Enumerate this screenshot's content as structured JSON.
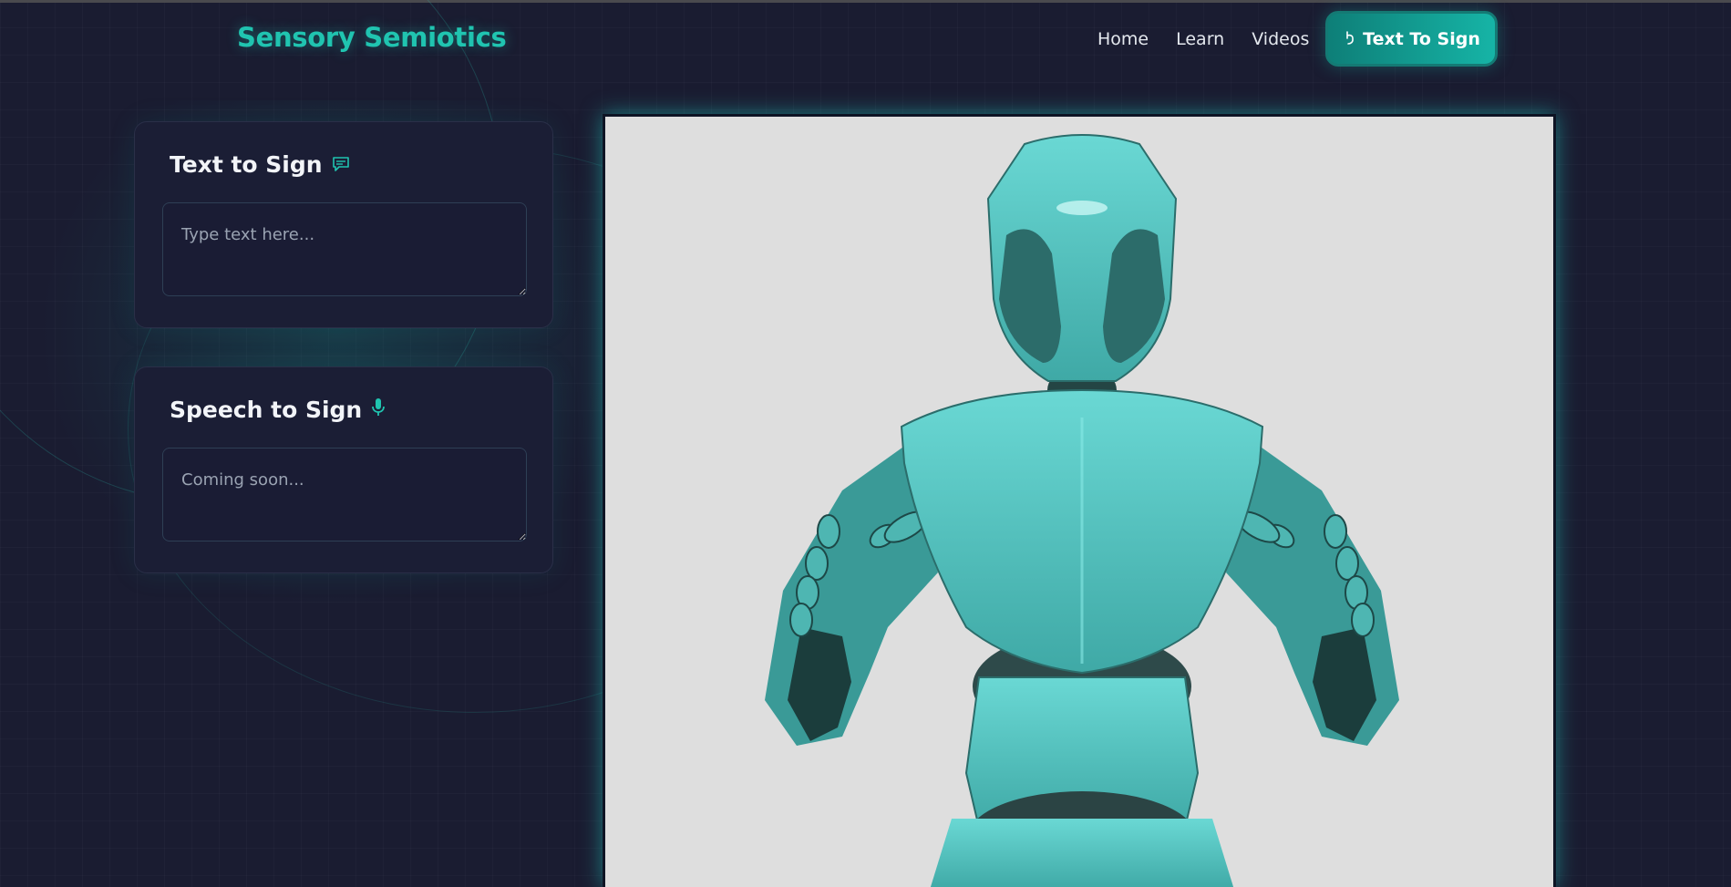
{
  "header": {
    "brand": "Sensory Semiotics",
    "nav": [
      "Home",
      "Learn",
      "Videos"
    ],
    "cta_label": "Text To Sign",
    "cta_icon": "hand-pointer-icon"
  },
  "panels": {
    "text_to_sign": {
      "title": "Text to Sign",
      "icon": "chat-message-icon",
      "placeholder": "Type text here..."
    },
    "speech_to_sign": {
      "title": "Speech to Sign",
      "icon": "microphone-icon",
      "placeholder": "Coming soon..."
    }
  },
  "colors": {
    "accent": "#20c4b0",
    "background": "#1a1c31",
    "card": "#1b1e35",
    "avatar": "#5ecfcb",
    "viewer_bg": "#dedede"
  }
}
